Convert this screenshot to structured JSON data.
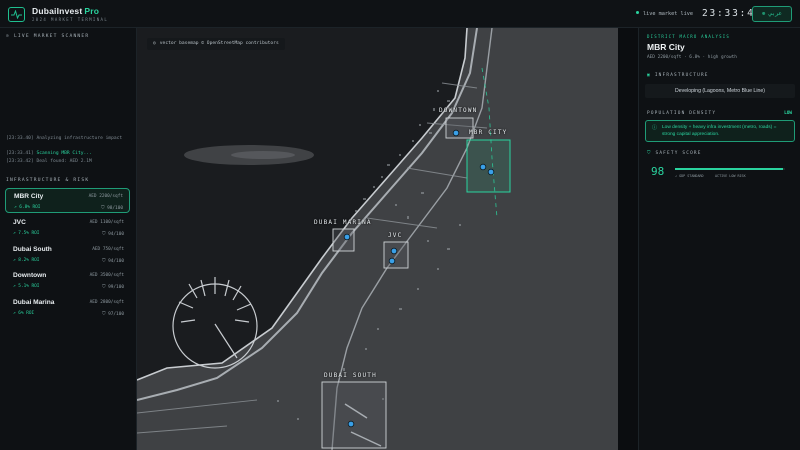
{
  "header": {
    "brand": "DubaiInvest",
    "brand_suffix": "Pro",
    "tagline": "2024 MARKET TERMINAL",
    "live_label": "live market live",
    "clock": "23:33:42",
    "lang_button": "عربي"
  },
  "left": {
    "scanner_title": "LIVE MARKET SCANNER",
    "logs": [
      {
        "time": "[23:33.40]",
        "text": "Analyzing infrastructure impact",
        "highlight": false
      },
      {
        "time": "[23:33.41]",
        "text": "Scanning MBR City...",
        "highlight": true
      },
      {
        "time": "[23:33.42]",
        "text": "Deal found: AED 2.1M",
        "highlight": false
      }
    ],
    "risk_title": "INFRASTRUCTURE & RISK",
    "districts": [
      {
        "name": "MBR City",
        "price": "AED 2200/sqft",
        "roi": "6.8% ROI",
        "safety": "98/100",
        "active": true
      },
      {
        "name": "JVC",
        "price": "AED 1100/sqft",
        "roi": "7.5% ROI",
        "safety": "94/100",
        "active": false
      },
      {
        "name": "Dubai South",
        "price": "AED 750/sqft",
        "roi": "8.2% ROI",
        "safety": "94/100",
        "active": false
      },
      {
        "name": "Downtown",
        "price": "AED 3500/sqft",
        "roi": "5.1% ROI",
        "safety": "99/100",
        "active": false
      },
      {
        "name": "Dubai Marina",
        "price": "AED 2800/sqft",
        "roi": "6% ROI",
        "safety": "97/100",
        "active": false
      }
    ]
  },
  "map": {
    "attribution": "vector basemap © OpenStreetMap contributors",
    "labels": {
      "downtown": "DOWNTOWN",
      "mbr": "MBR CITY",
      "marina": "DUBAI MARINA",
      "jvc": "JVC",
      "south": "DUBAI SOUTH"
    }
  },
  "right": {
    "kicker": "DISTRICT MACRO ANALYSIS",
    "title": "MBR City",
    "subtitle": "AED 2200/sqft  ·  6.8%  ·  high growth",
    "infra_title": "INFRASTRUCTURE",
    "infra_value": "Developing (Lagoons, Metro Blue Line)",
    "density_title": "POPULATION DENSITY",
    "density_value": "LOW",
    "density_note": "Low density + heavy infra investment (metro, roads) = strong capital appreciation.",
    "safety_title": "SAFETY SCORE",
    "safety_score": 98,
    "safety_a": "↗ GDP STANDARD",
    "safety_b": "ACTIVE LOW RISK"
  },
  "colors": {
    "accent": "#2ad49f",
    "panel": "#0e1114",
    "map_land": "#3f4144",
    "map_sea": "#1a1c1f"
  },
  "icons": {
    "logo": "pulse-icon",
    "scanner": "radar-icon",
    "infra": "building-icon",
    "density": "people-icon",
    "safety": "shield-icon",
    "info": "info-icon",
    "map": "pin-icon"
  }
}
